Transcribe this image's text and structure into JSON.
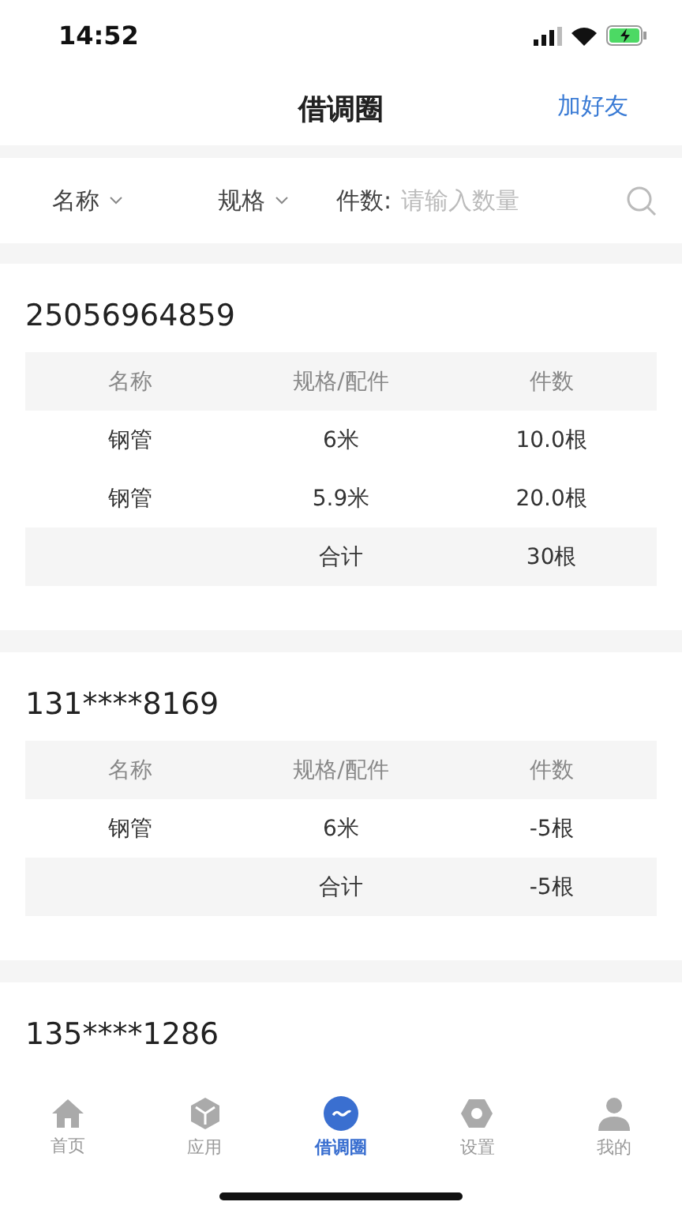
{
  "status_bar": {
    "time": "14:52"
  },
  "header": {
    "title": "借调圈",
    "action": "加好友"
  },
  "filters": {
    "name": "名称",
    "spec": "规格",
    "count_label": "件数:",
    "count_placeholder": "请输入数量"
  },
  "records": [
    {
      "id": "25056964859",
      "columns": [
        "名称",
        "规格/配件",
        "件数"
      ],
      "rows": [
        {
          "kind": "item",
          "cells": [
            "钢管",
            "6米",
            "10.0根"
          ]
        },
        {
          "kind": "item",
          "cells": [
            "钢管",
            "5.9米",
            "20.0根"
          ]
        },
        {
          "kind": "total",
          "cells": [
            "",
            "合计",
            "30根"
          ]
        }
      ]
    },
    {
      "id": "131****8169",
      "columns": [
        "名称",
        "规格/配件",
        "件数"
      ],
      "rows": [
        {
          "kind": "item",
          "cells": [
            "钢管",
            "6米",
            "-5根"
          ]
        },
        {
          "kind": "total",
          "cells": [
            "",
            "合计",
            "-5根"
          ]
        }
      ]
    },
    {
      "id": "135****1286"
    }
  ],
  "tab_bar": [
    {
      "label": "首页",
      "kind": "home",
      "selected": false
    },
    {
      "label": "应用",
      "kind": "cube",
      "selected": false
    },
    {
      "label": "借调圈",
      "kind": "circle",
      "selected": true
    },
    {
      "label": "设置",
      "kind": "gear",
      "selected": false
    },
    {
      "label": "我的",
      "kind": "person",
      "selected": false
    }
  ]
}
